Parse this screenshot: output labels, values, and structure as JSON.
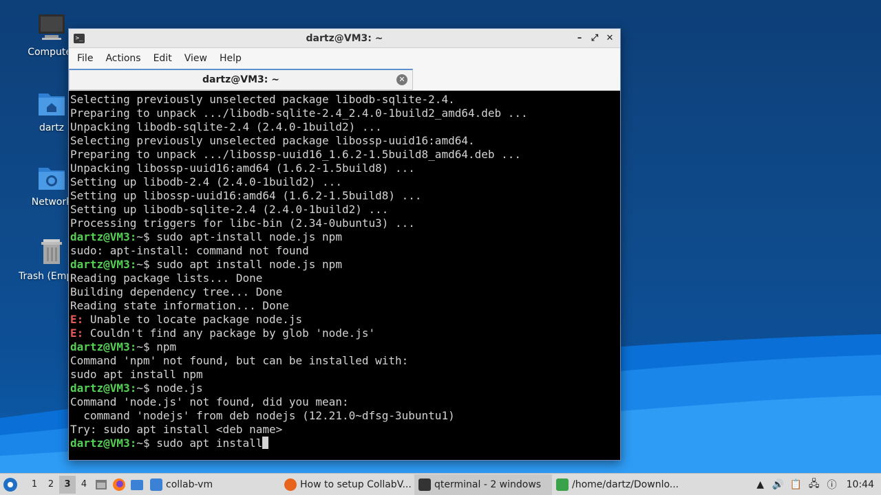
{
  "desktop": {
    "icons": [
      {
        "label": "Computer",
        "icon": "computer-icon"
      },
      {
        "label": "dartz",
        "icon": "home-folder-icon"
      },
      {
        "label": "Network",
        "icon": "network-folder-icon"
      },
      {
        "label": "Trash (Empty)",
        "icon": "trash-icon"
      }
    ]
  },
  "window": {
    "title": "dartz@VM3: ~",
    "controls": {
      "minimize": "–",
      "maximize": "⤢",
      "close": "✕"
    },
    "menu": [
      "File",
      "Actions",
      "Edit",
      "View",
      "Help"
    ],
    "tab": {
      "label": "dartz@VM3: ~",
      "close": "✕"
    }
  },
  "terminal": {
    "lines": [
      {
        "text": "Selecting previously unselected package libodb-sqlite-2.4."
      },
      {
        "text": "Preparing to unpack .../libodb-sqlite-2.4_2.4.0-1build2_amd64.deb ..."
      },
      {
        "text": "Unpacking libodb-sqlite-2.4 (2.4.0-1build2) ..."
      },
      {
        "text": "Selecting previously unselected package libossp-uuid16:amd64."
      },
      {
        "text": "Preparing to unpack .../libossp-uuid16_1.6.2-1.5build8_amd64.deb ..."
      },
      {
        "text": "Unpacking libossp-uuid16:amd64 (1.6.2-1.5build8) ..."
      },
      {
        "text": "Setting up libodb-2.4 (2.4.0-1build2) ..."
      },
      {
        "text": "Setting up libossp-uuid16:amd64 (1.6.2-1.5build8) ..."
      },
      {
        "text": "Setting up libodb-sqlite-2.4 (2.4.0-1build2) ..."
      },
      {
        "text": "Processing triggers for libc-bin (2.34-0ubuntu3) ..."
      },
      {
        "prompt": "dartz@VM3:",
        "text": "~$ sudo apt-install node.js npm"
      },
      {
        "text": "sudo: apt-install: command not found"
      },
      {
        "prompt": "dartz@VM3:",
        "text": "~$ sudo apt install node.js npm"
      },
      {
        "text": "Reading package lists... Done"
      },
      {
        "text": "Building dependency tree... Done"
      },
      {
        "text": "Reading state information... Done"
      },
      {
        "err": "E:",
        "text": " Unable to locate package node.js"
      },
      {
        "err": "E:",
        "text": " Couldn't find any package by glob 'node.js'"
      },
      {
        "prompt": "dartz@VM3:",
        "text": "~$ npm"
      },
      {
        "text": "Command 'npm' not found, but can be installed with:"
      },
      {
        "text": "sudo apt install npm"
      },
      {
        "prompt": "dartz@VM3:",
        "text": "~$ node.js"
      },
      {
        "text": "Command 'node.js' not found, did you mean:"
      },
      {
        "text": "  command 'nodejs' from deb nodejs (12.21.0~dfsg-3ubuntu1)"
      },
      {
        "text": "Try: sudo apt install <deb name>"
      },
      {
        "prompt": "dartz@VM3:",
        "text": "~$ sudo apt install",
        "cursor": true
      }
    ]
  },
  "taskbar": {
    "workspaces": [
      "1",
      "2",
      "3",
      "4"
    ],
    "active_workspace": "3",
    "tasks": [
      {
        "label": "collab-vm",
        "icon": "folder-icon",
        "color": "#3b82d6"
      },
      {
        "label": "How to setup CollabV...",
        "icon": "firefox-icon",
        "color": "#e8641c"
      },
      {
        "label": "qterminal - 2 windows",
        "icon": "terminal-icon",
        "color": "#333333"
      },
      {
        "label": "/home/dartz/Downlo...",
        "icon": "archive-icon",
        "color": "#3aa34a"
      }
    ],
    "clock": "10:44"
  }
}
